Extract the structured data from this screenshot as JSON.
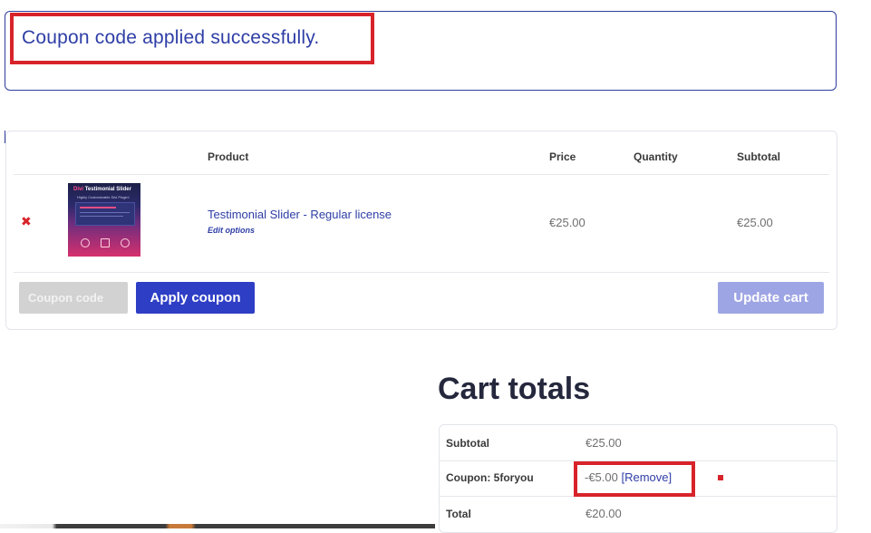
{
  "notice": {
    "message": "Coupon code applied successfully."
  },
  "cart_table": {
    "headers": {
      "product": "Product",
      "price": "Price",
      "quantity": "Quantity",
      "subtotal": "Subtotal"
    },
    "items": [
      {
        "remove_glyph": "✖",
        "thumbnail": {
          "title_accent": "Divi",
          "title": "Testimonial Slider",
          "subtitle": "Highly Customizable Divi Plugin!"
        },
        "name": "Testimonial Slider - Regular license",
        "edit_label": "Edit options",
        "price": "€25.00",
        "subtotal": "€25.00"
      }
    ]
  },
  "coupon": {
    "placeholder": "Coupon code",
    "apply_label": "Apply coupon"
  },
  "update_label": "Update cart",
  "totals": {
    "title": "Cart totals",
    "rows": {
      "subtotal": {
        "label": "Subtotal",
        "value": "€25.00"
      },
      "coupon": {
        "label": "Coupon: 5foryou",
        "value": "-€5.00",
        "remove_label": "[Remove]"
      },
      "total": {
        "label": "Total",
        "value": "€20.00"
      }
    }
  },
  "colors": {
    "accent": "#2e3ec5",
    "highlight": "#d8232a",
    "disabled_button": "#9ea5e4"
  }
}
